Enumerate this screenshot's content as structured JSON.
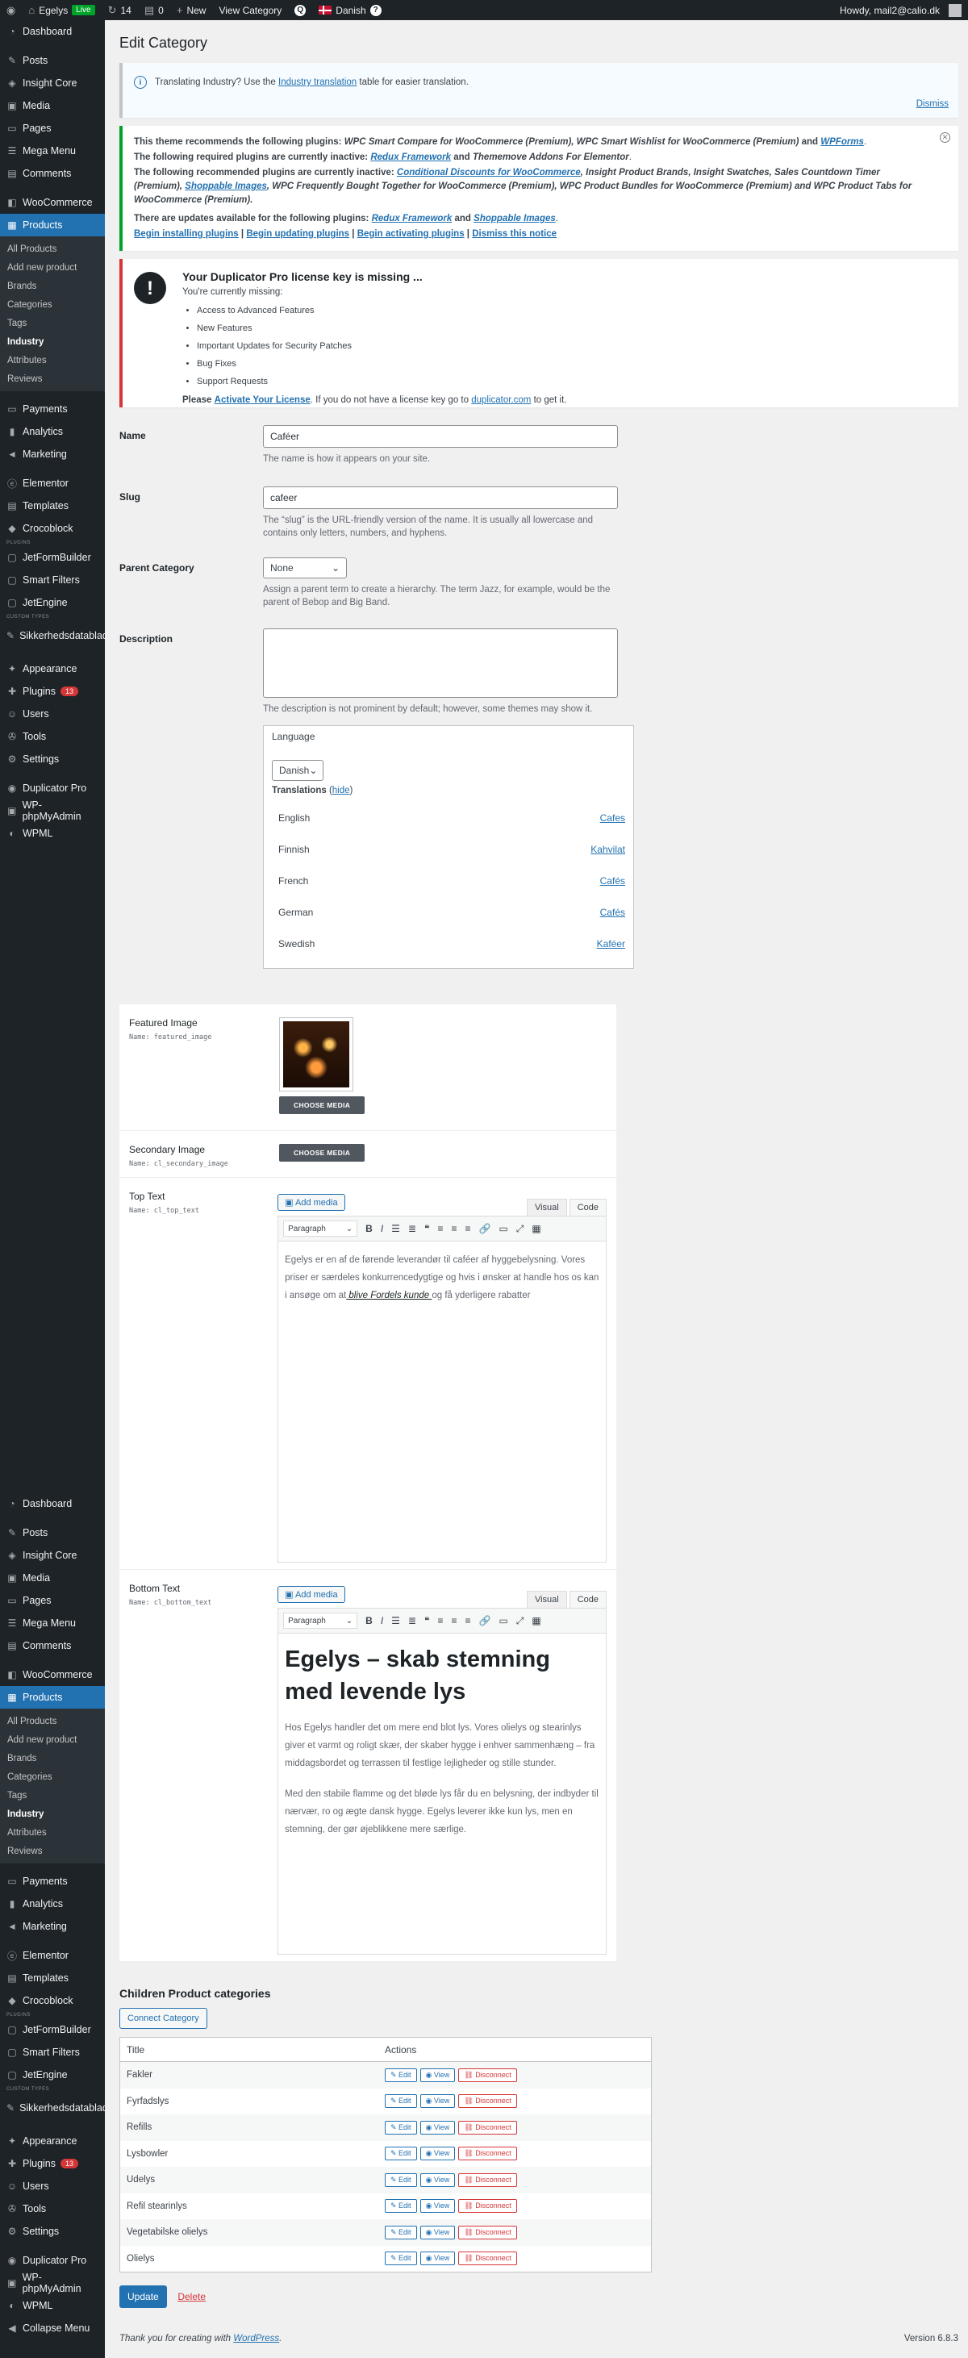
{
  "adminbar": {
    "site": "Egelys",
    "live": "Live",
    "updates": "14",
    "comments": "0",
    "new": "New",
    "view": "View Category",
    "lang": "Danish",
    "greeting": "Howdy, mail2@calio.dk"
  },
  "sidebar": {
    "items_a": [
      "Dashboard",
      "Posts",
      "Insight Core",
      "Media",
      "Pages",
      "Mega Menu",
      "Comments",
      "WooCommerce",
      "Products"
    ],
    "sub": [
      "All Products",
      "Add new product",
      "Brands",
      "Categories",
      "Tags",
      "Industry",
      "Attributes",
      "Reviews"
    ],
    "items_b": [
      "Payments",
      "Analytics",
      "Marketing",
      "Elementor",
      "Templates",
      "Crocoblock"
    ],
    "label_plugins": "PLUGINS",
    "items_c": [
      "JetFormBuilder",
      "Smart Filters",
      "JetEngine"
    ],
    "label_cpt": "CUSTOM TYPES",
    "sikk": "Sikkerhedsdatablad",
    "items_d": [
      "Appearance",
      "Plugins",
      "Users",
      "Tools",
      "Settings"
    ],
    "plugins_count": "13",
    "items_e": [
      "Duplicator Pro",
      "WP-phpMyAdmin",
      "WPML"
    ],
    "collapse": "Collapse Menu"
  },
  "page": {
    "title": "Edit Category"
  },
  "notice_translate": {
    "text": "Translating Industry? Use the",
    "link": "Industry translation",
    "rest": "table for easier translation.",
    "dismiss": "Dismiss"
  },
  "notice_plugins": {
    "l1a": "This theme recommends the following plugins:",
    "l1b": "WPC Smart Compare for WooCommerce (Premium), WPC Smart Wishlist for WooCommerce (Premium)",
    "l1c": "and",
    "l1d": "WPForms",
    "l2a": "The following required plugins are currently inactive:",
    "l2b": "Redux Framework",
    "l2c": "and",
    "l2d": "Thememove Addons For Elementor",
    "l3a": "The following recommended plugins are currently inactive:",
    "l3b": "Conditional Discounts for WooCommerce",
    "l3c": ", Insight Product Brands, Insight Swatches, Sales Countdown Timer (Premium),",
    "l3d": "Shoppable Images",
    "l3e": ", WPC Frequently Bought Together for WooCommerce (Premium), WPC Product Bundles for WooCommerce (Premium) and WPC Product Tabs for WooCommerce (Premium).",
    "l4a": "There are updates available for the following plugins:",
    "l4b": "Redux Framework",
    "l4c": "and",
    "l4d": "Shoppable Images",
    "links": [
      "Begin installing plugins",
      "Begin updating plugins",
      "Begin activating plugins",
      "Dismiss this notice"
    ]
  },
  "notice_dup": {
    "title": "Your Duplicator Pro license key is missing ...",
    "sub": "You're currently missing:",
    "items": [
      "Access to Advanced Features",
      "New Features",
      "Important Updates for Security Patches",
      "Bug Fixes",
      "Support Requests"
    ],
    "please": "Please",
    "activate": "Activate Your License",
    "mid": ". If you do not have a license key go to",
    "site": "duplicator.com",
    "end": "to get it."
  },
  "form": {
    "name_label": "Name",
    "name_value": "Caféer",
    "name_desc": "The name is how it appears on your site.",
    "slug_label": "Slug",
    "slug_value": "cafeer",
    "slug_desc": "The “slug” is the URL-friendly version of the name. It is usually all lowercase and contains only letters, numbers, and hyphens.",
    "parent_label": "Parent Category",
    "parent_value": "None",
    "parent_desc": "Assign a parent term to create a hierarchy. The term Jazz, for example, would be the parent of Bebop and Big Band.",
    "desc_label": "Description",
    "desc_desc": "The description is not prominent by default; however, some themes may show it."
  },
  "language": {
    "title": "Language",
    "value": "Danish",
    "translations": "Translations",
    "hide": "hide",
    "rows": [
      [
        "English",
        "Cafes"
      ],
      [
        "Finnish",
        "Kahvilat"
      ],
      [
        "French",
        "Cafés"
      ],
      [
        "German",
        "Cafés"
      ],
      [
        "Swedish",
        "Kaféer"
      ]
    ]
  },
  "acf": {
    "featured": "Featured Image",
    "featured_name": "Name: featured_image",
    "choose": "CHOOSE MEDIA",
    "secondary": "Secondary Image",
    "secondary_name": "Name: cl_secondary_image",
    "top": "Top Text",
    "top_name": "Name: cl_top_text",
    "bottom": "Bottom Text",
    "bottom_name": "Name: cl_bottom_text",
    "add_media": "Add media",
    "visual": "Visual",
    "code": "Code",
    "paragraph": "Paragraph",
    "top_text_a": "Egelys er en af de førende leverandør til caféer af hyggebelysning. Vores priser er særdeles konkurrencedygtige og hvis i ønsker at handle hos os kan i ansøge om at",
    "top_link": " blive Fordels kunde ",
    "top_text_b": "og få yderligere rabatter",
    "bottom_h": "Egelys – skab stemning med levende lys",
    "bottom_p1": "Hos Egelys handler det om mere end blot lys. Vores olielys og stearinlys giver et varmt og roligt skær, der skaber hygge i enhver sammenhæng – fra middagsbordet og terrassen til festlige lejligheder og stille stunder.",
    "bottom_p2": "Med den stabile flamme og det bløde lys får du en belysning, der indbyder til nærvær, ro og ægte dansk hygge. Egelys leverer ikke kun lys, men en stemning, der gør øjeblikkene mere særlige."
  },
  "children": {
    "title": "Children Product categories",
    "connect": "Connect Category",
    "col_title": "Title",
    "col_actions": "Actions",
    "edit": "Edit",
    "view": "View",
    "disconnect": "Disconnect",
    "rows": [
      "Fakler",
      "Fyrfadslys",
      "Refills",
      "Lysbowler",
      "Udelys",
      "Refil stearinlys",
      "Vegetabilske olielys",
      "Olielys"
    ]
  },
  "actions": {
    "update": "Update",
    "delete": "Delete"
  },
  "footer": {
    "thanks": "Thank you for creating with",
    "wp": "WordPress",
    "version": "Version 6.8.3"
  }
}
